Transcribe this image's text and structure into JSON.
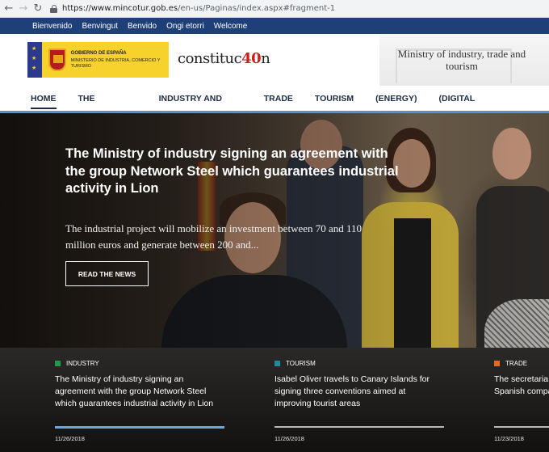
{
  "browser": {
    "url_domain": "https://www.mincotur.gob.es",
    "url_path": "/en-us/Paginas/index.aspx#fragment-1"
  },
  "language_bar": [
    "Bienvenido",
    "Benvingut",
    "Benvido",
    "Ongi etorri",
    "Welcome"
  ],
  "header": {
    "gov_logo": {
      "line1": "Gobierno de España",
      "line2": "Ministerio de Industria, Comercio y Turismo"
    },
    "constitucion": {
      "prefix": "constituc",
      "highlight": "40",
      "suffix": "n"
    },
    "ministry_title": "Ministry of industry, trade and tourism"
  },
  "main_nav": [
    {
      "label": "HOME",
      "active": true
    },
    {
      "label": "THE MINISTRY",
      "active": false
    },
    {
      "label": "INDUSTRY AND SME",
      "active": false
    },
    {
      "label": "TRADE",
      "active": false
    },
    {
      "label": "TOURISM",
      "active": false
    },
    {
      "label": "(ENERGY)",
      "active": false
    },
    {
      "label": "(DIGITAL PROGRESS)",
      "active": false
    }
  ],
  "hero": {
    "title": "The Ministry of industry signing an agreement with the group Network Steel which guarantees industrial activity in Lion",
    "description": "The industrial project will mobilize an investment between 70 and 110 million euros and generate between 200 and...",
    "read_button": "READ THE NEWS"
  },
  "news": [
    {
      "category": "INDUSTRY",
      "color": "#1f9a4c",
      "title_lines": [
        "The Ministry of industry signing an",
        "agreement with the group Network Steel",
        "which guarantees industrial activity in Lion"
      ],
      "date": "11/26/2018",
      "active": true
    },
    {
      "category": "TOURISM",
      "color": "#1f8a9a",
      "title_lines": [
        "Isabel Oliver travels to Canary Islands for",
        "signing three conventions aimed at",
        "improving tourist areas"
      ],
      "date": "11/26/2018",
      "active": false
    },
    {
      "category": "TRADE",
      "color": "#e36a1c",
      "title_lines": [
        "The secretaria",
        "Spanish compa"
      ],
      "date": "11/23/2018",
      "active": false
    }
  ]
}
